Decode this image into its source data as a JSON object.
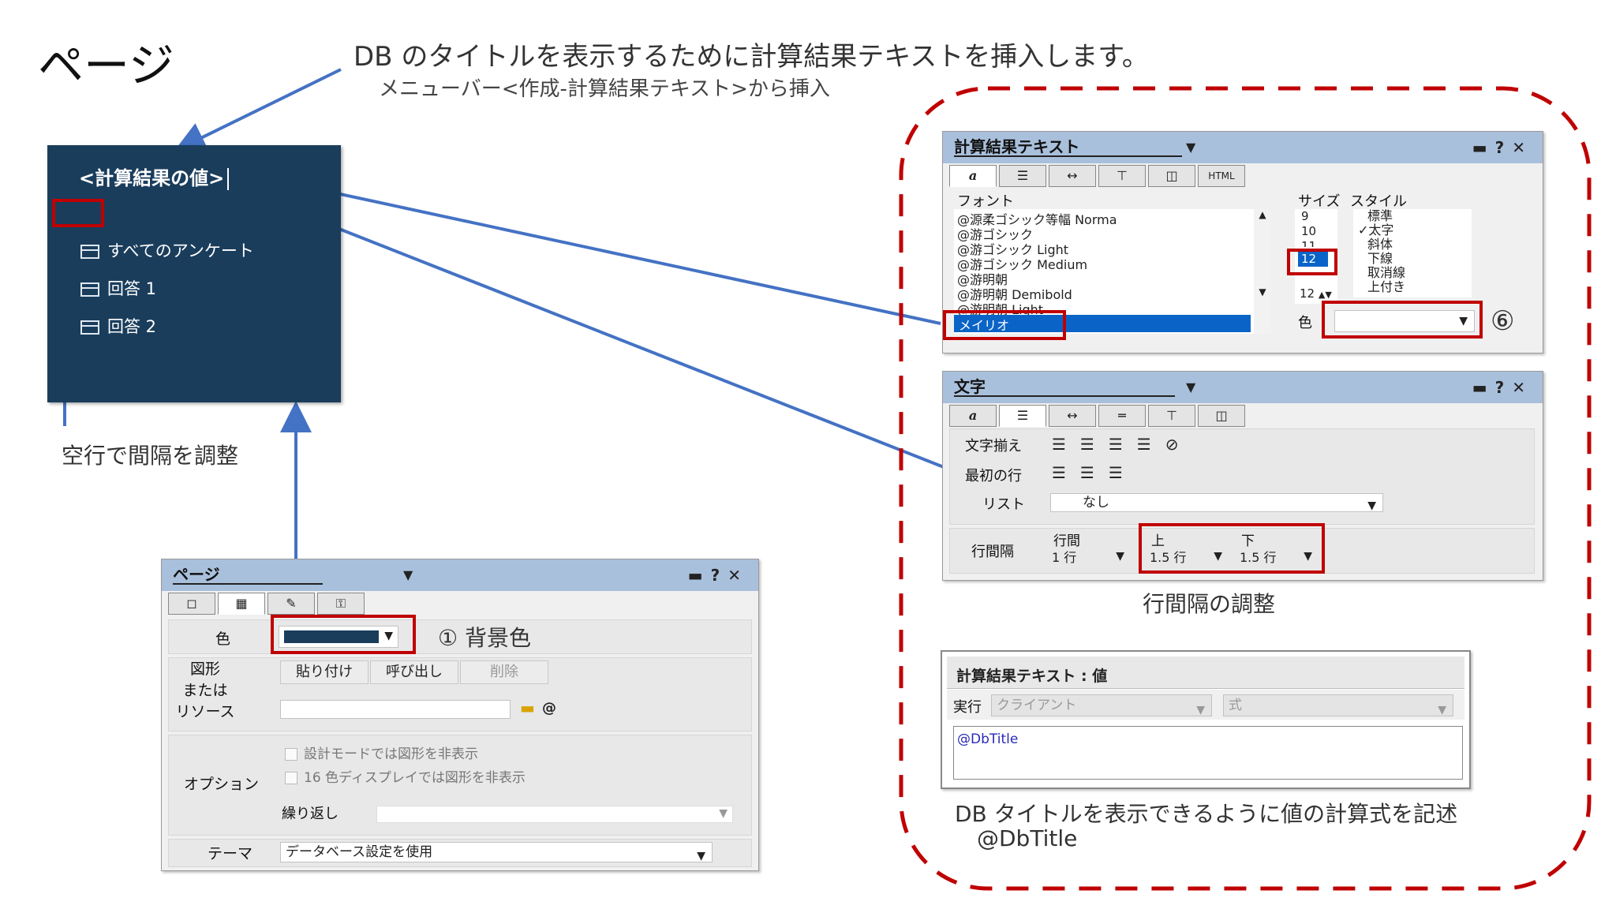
{
  "page": {
    "title": "ページ",
    "heading": "DB のタイトルを表示するために計算結果テキストを挿入します。",
    "subheading": "メニューバー<作成-計算結果テキスト>から挿入"
  },
  "preview": {
    "bg_color": "#1a3d5c",
    "title_text": "<計算結果の値>",
    "items": [
      "すべてのアンケート",
      "回答 1",
      "回答 2"
    ],
    "caption": "空行で間隔を調整"
  },
  "page_dialog": {
    "title": "ページ",
    "color_label": "色",
    "color_value": "#1a3d5c",
    "annotation": "① 背景色",
    "shape_label": "図形\nまたは\nリソース",
    "buttons": [
      "貼り付け",
      "呼び出し",
      "削除"
    ],
    "resource_at": "@",
    "option_label": "オプション",
    "options": [
      "設計モードでは図形を非表示",
      "16 色ディスプレイでは図形を非表示"
    ],
    "repeat_label": "繰り返し",
    "theme_label": "テーマ",
    "theme_value": "データベース設定を使用"
  },
  "calc_dialog": {
    "title": "計算結果テキスト",
    "html_tab": "HTML",
    "font_label": "フォント",
    "fonts": [
      "@源柔ゴシック等幅 Norma",
      "@游ゴシック",
      "@游ゴシック Light",
      "@游ゴシック Medium",
      "@游明朝",
      "@游明朝 Demibold",
      "@游明朝 Light"
    ],
    "selected_font": "メイリオ",
    "size_label": "サイズ",
    "sizes": [
      "9",
      "10",
      "11"
    ],
    "selected_size": "12",
    "size_value": "12",
    "style_label": "スタイル",
    "styles": [
      "標準",
      "太字",
      "斜体",
      "下線",
      "取消線",
      "上付き"
    ],
    "checked_style": "✓",
    "color_label": "色",
    "annotation": "⑥"
  },
  "text_dialog": {
    "title": "文字",
    "align_label": "文字揃え",
    "first_line_label": "最初の行",
    "list_label": "リスト",
    "list_value": "なし",
    "spacing_label": "行間隔",
    "line_label": "行間",
    "line_value": "1 行",
    "above_label": "上",
    "above_value": "1.5 行",
    "below_label": "下",
    "below_value": "1.5 行",
    "caption": "行間隔の調整"
  },
  "formula_dialog": {
    "title": "計算結果テキスト : 値",
    "run_label": "実行",
    "run_value": "クライアント",
    "type_value": "式",
    "formula": "@DbTitle",
    "caption_line1": "DB タイトルを表示できるように値の計算式を記述",
    "caption_line2": "@DbTitle"
  },
  "colors": {
    "accent_red": "#c00000",
    "arrow_blue": "#4472c4",
    "panel_title": "#a9c0dc",
    "selection_blue": "#0a64c8"
  }
}
